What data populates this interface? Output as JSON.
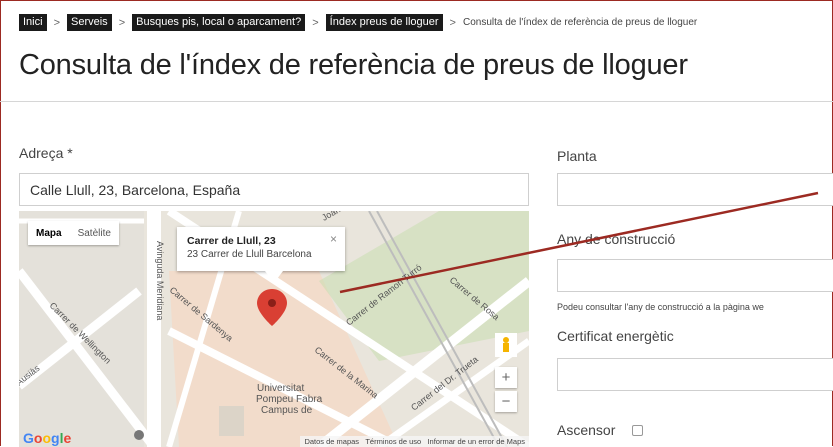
{
  "breadcrumb": {
    "items": [
      "Inici",
      "Serveis",
      "Busques pis, local o aparcament?",
      "Índex preus de lloguer"
    ],
    "separator": ">",
    "current": "Consulta de l'índex de referència de preus de lloguer"
  },
  "page_title": "Consulta de l'índex de referència de preus de lloguer",
  "form": {
    "address_label": "Adreça *",
    "address_value": "Calle Llull, 23, Barcelona, España",
    "floor_label": "Planta",
    "floor_value": "",
    "year_label": "Any de construcció",
    "year_value": "",
    "year_help": "Podeu consultar l'any de construcció a la pàgina we",
    "certificate_label": "Certificat energètic",
    "certificate_value": "",
    "elevator_label": "Ascensor"
  },
  "map": {
    "type_map": "Mapa",
    "type_satellite": "Satèlite",
    "info_title": "Carrer de Llull, 23",
    "info_subtitle": "23 Carrer de Llull Barcelona",
    "info_close": "×",
    "zoom_in": "+",
    "zoom_out": "−",
    "footer_data": "Datos de mapas",
    "footer_terms": "Términos de uso",
    "footer_report": "Informar de un error de Maps",
    "google": "Google",
    "street_labels": [
      "Avinguda Meridiana",
      "Carrer de Wellington",
      "Carrer de Sardenya",
      "Carrer de la Marina",
      "Carrer de Ramon Turró",
      "Carrer del Dr. Trueta",
      "Carrer de Rosa",
      "Ausiàs",
      "Joan",
      "Universitat Pompeu Fabra Campus de"
    ],
    "colors": {
      "road": "#ffffff",
      "block": "#e9e5dc",
      "campus": "#f2dccb",
      "park": "#c8dfb0",
      "pin": "#d93f33",
      "rail": "#bdbdbd"
    }
  },
  "colors": {
    "accent": "#9c2a22",
    "crumb_bg": "#1a1a1a"
  }
}
